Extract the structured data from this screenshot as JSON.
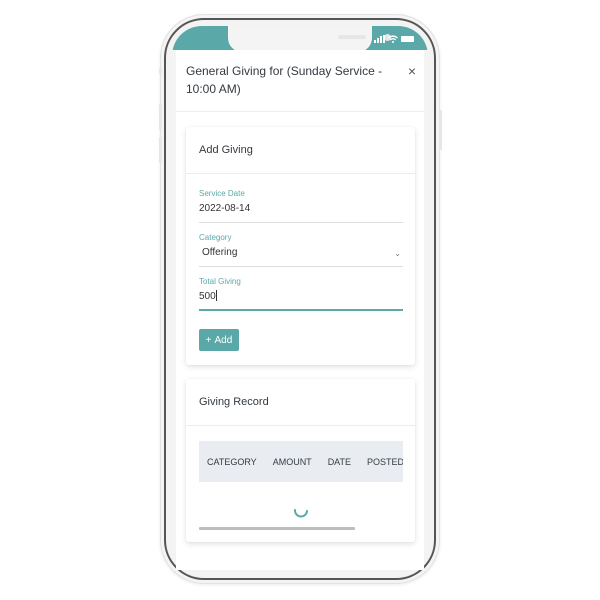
{
  "status_bar": {
    "icons": [
      "signal-icon",
      "wifi-icon",
      "battery-icon"
    ]
  },
  "modal": {
    "title": "General Giving for (Sunday Service - 10:00 AM)",
    "close_icon": "×"
  },
  "add_giving": {
    "title": "Add Giving",
    "fields": {
      "service_date": {
        "label": "Service Date",
        "value": "2022-08-14"
      },
      "category": {
        "label": "Category",
        "value": "Offering",
        "chevron": "⌄"
      },
      "total_giving": {
        "label": "Total Giving",
        "value": "500"
      }
    },
    "add_button": {
      "icon": "+",
      "label": "Add"
    }
  },
  "giving_record": {
    "title": "Giving Record",
    "columns": [
      "CATEGORY",
      "AMOUNT",
      "DATE",
      "POSTED BY"
    ],
    "rows": [],
    "loading": true
  },
  "colors": {
    "accent": "#5aa9a8",
    "table_header_bg": "#e9edf1"
  }
}
